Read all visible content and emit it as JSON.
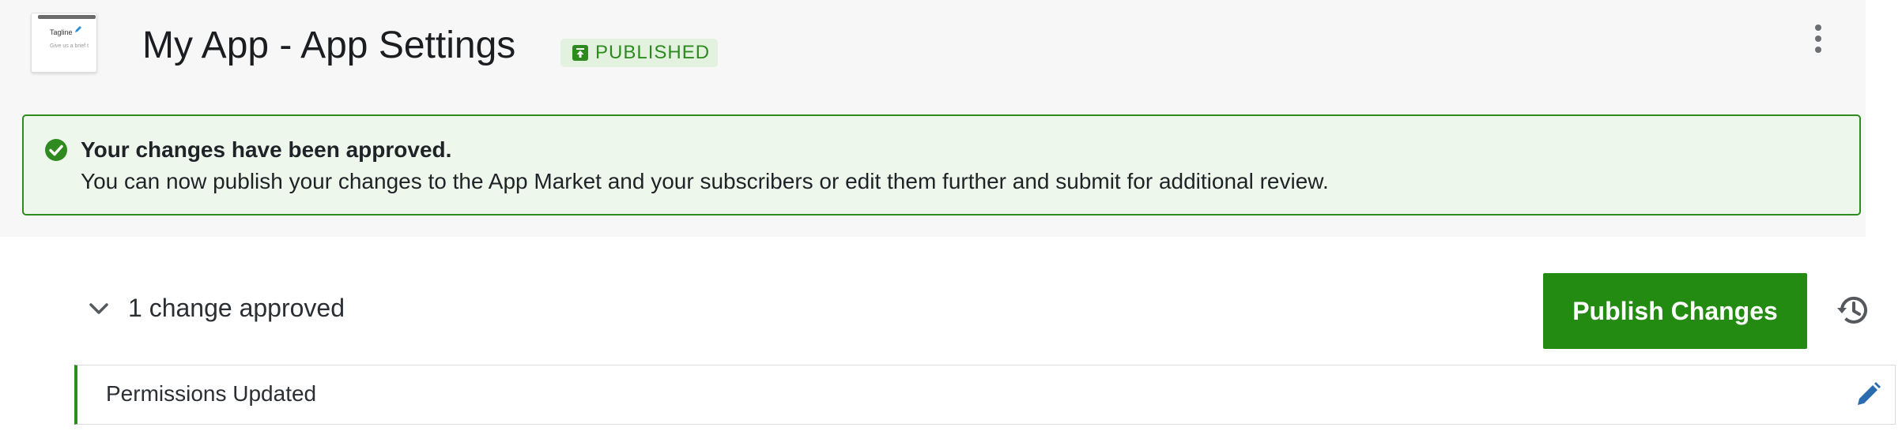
{
  "header": {
    "thumbnail": {
      "title": "Tagline",
      "subtitle": "Give us a brief t"
    },
    "title": "My App - App Settings",
    "status_badge": "PUBLISHED"
  },
  "alert": {
    "title": "Your changes have been approved.",
    "body": "You can now publish your changes to the App Market and your subscribers or edit them further and submit for additional review."
  },
  "changes": {
    "summary": "1 change approved",
    "publish_label": "Publish Changes",
    "items": [
      {
        "label": "Permissions Updated"
      }
    ]
  },
  "icons": {
    "badge": "published-icon",
    "menu": "kebab-menu-icon",
    "alert": "check-circle-icon",
    "toggle": "chevron-down-icon",
    "history": "history-icon",
    "edit": "pencil-icon"
  },
  "colors": {
    "accent_green": "#238a12",
    "alert_background": "#eef7ec",
    "badge_background": "#e3f1df",
    "edit_blue": "#2b6cb0"
  }
}
